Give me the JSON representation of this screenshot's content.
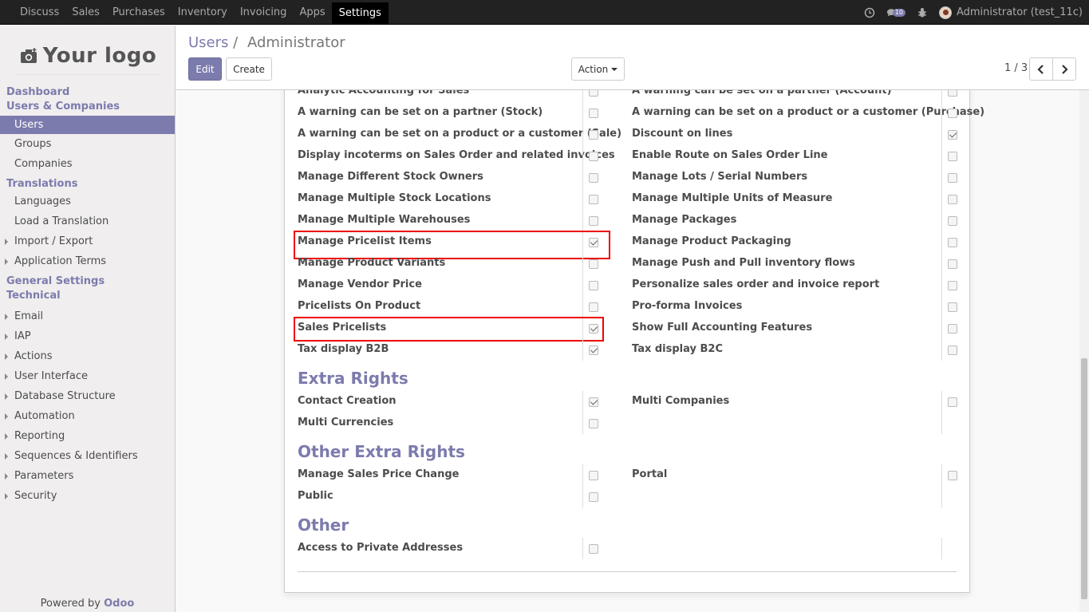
{
  "topbar": {
    "menu": [
      "Discuss",
      "Sales",
      "Purchases",
      "Inventory",
      "Invoicing",
      "Apps",
      "Settings"
    ],
    "active": "Settings",
    "message_count": "10",
    "user": "Administrator (test_11c)"
  },
  "sidebar": {
    "logo_text": "Your logo",
    "nav": [
      {
        "kind": "hdr",
        "label": "Dashboard"
      },
      {
        "kind": "hdr",
        "label": "Users & Companies"
      },
      {
        "kind": "item",
        "label": "Users",
        "active": true
      },
      {
        "kind": "item",
        "label": "Groups"
      },
      {
        "kind": "item",
        "label": "Companies"
      },
      {
        "kind": "hdr",
        "label": "Translations"
      },
      {
        "kind": "item",
        "label": "Languages"
      },
      {
        "kind": "item",
        "label": "Load a Translation"
      },
      {
        "kind": "tree",
        "label": "Import / Export"
      },
      {
        "kind": "tree",
        "label": "Application Terms"
      },
      {
        "kind": "hdr",
        "label": "General Settings"
      },
      {
        "kind": "hdr",
        "label": "Technical"
      },
      {
        "kind": "tree",
        "label": "Email"
      },
      {
        "kind": "tree",
        "label": "IAP"
      },
      {
        "kind": "tree",
        "label": "Actions"
      },
      {
        "kind": "tree",
        "label": "User Interface"
      },
      {
        "kind": "tree",
        "label": "Database Structure"
      },
      {
        "kind": "tree",
        "label": "Automation"
      },
      {
        "kind": "tree",
        "label": "Reporting"
      },
      {
        "kind": "tree",
        "label": "Sequences & Identifiers"
      },
      {
        "kind": "tree",
        "label": "Parameters"
      },
      {
        "kind": "tree",
        "label": "Security"
      }
    ],
    "powered_prefix": "Powered by",
    "powered_brand": "Odoo"
  },
  "control_panel": {
    "breadcrumb_parent": "Users",
    "breadcrumb_sep": "/",
    "breadcrumb_current": "Administrator",
    "edit_label": "Edit",
    "create_label": "Create",
    "action_label": "Action",
    "pager": "1 / 3"
  },
  "form": {
    "rights_rows": [
      [
        {
          "label": "Analytic Accounting for Sales",
          "checked": false
        },
        {
          "label": "A warning can be set on a partner (Account)",
          "checked": false
        }
      ],
      [
        {
          "label": "A warning can be set on a partner (Stock)",
          "checked": false
        },
        {
          "label": "A warning can be set on a product or a customer (Purchase)",
          "checked": false
        }
      ],
      [
        {
          "label": "A warning can be set on a product or a customer (Sale)",
          "checked": false
        },
        {
          "label": "Discount on lines",
          "checked": true
        }
      ],
      [
        {
          "label": "Display incoterms on Sales Order and related invoices",
          "checked": false
        },
        {
          "label": "Enable Route on Sales Order Line",
          "checked": false
        }
      ],
      [
        {
          "label": "Manage Different Stock Owners",
          "checked": false
        },
        {
          "label": "Manage Lots / Serial Numbers",
          "checked": false
        }
      ],
      [
        {
          "label": "Manage Multiple Stock Locations",
          "checked": false
        },
        {
          "label": "Manage Multiple Units of Measure",
          "checked": false
        }
      ],
      [
        {
          "label": "Manage Multiple Warehouses",
          "checked": false
        },
        {
          "label": "Manage Packages",
          "checked": false
        }
      ],
      [
        {
          "label": "Manage Pricelist Items",
          "checked": true,
          "highlight": true
        },
        {
          "label": "Manage Product Packaging",
          "checked": false
        }
      ],
      [
        {
          "label": "Manage Product Variants",
          "checked": false
        },
        {
          "label": "Manage Push and Pull inventory flows",
          "checked": false
        }
      ],
      [
        {
          "label": "Manage Vendor Price",
          "checked": false
        },
        {
          "label": "Personalize sales order and invoice report",
          "checked": false
        }
      ],
      [
        {
          "label": "Pricelists On Product",
          "checked": false
        },
        {
          "label": "Pro-forma Invoices",
          "checked": false
        }
      ],
      [
        {
          "label": "Sales Pricelists",
          "checked": true,
          "highlight": true
        },
        {
          "label": "Show Full Accounting Features",
          "checked": false
        }
      ],
      [
        {
          "label": "Tax display B2B",
          "checked": true
        },
        {
          "label": "Tax display B2C",
          "checked": false
        }
      ]
    ],
    "extra_rights_title": "Extra Rights",
    "extra_rights_rows": [
      [
        {
          "label": "Contact Creation",
          "checked": true
        },
        {
          "label": "Multi Companies",
          "checked": false
        }
      ],
      [
        {
          "label": "Multi Currencies",
          "checked": false
        },
        null
      ]
    ],
    "other_extra_rights_title": "Other Extra Rights",
    "other_extra_rights_rows": [
      [
        {
          "label": "Manage Sales Price Change",
          "checked": false
        },
        {
          "label": "Portal",
          "checked": false
        }
      ],
      [
        {
          "label": "Public",
          "checked": false
        },
        null
      ]
    ],
    "other_title": "Other",
    "other_rows": [
      [
        {
          "label": "Access to Private Addresses",
          "checked": false
        },
        null
      ]
    ]
  }
}
